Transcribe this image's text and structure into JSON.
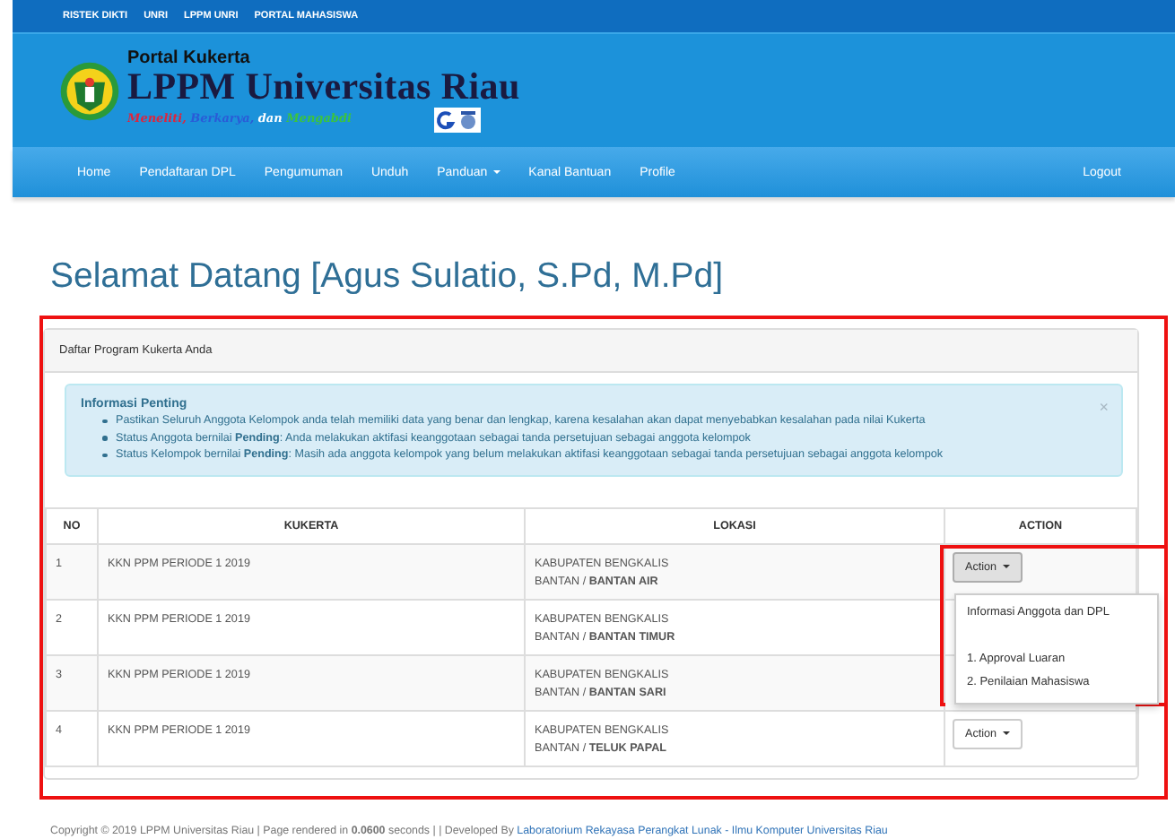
{
  "top_links": [
    "RISTEK DIKTI",
    "UNRI",
    "LPPM UNRI",
    "PORTAL MAHASISWA"
  ],
  "brand": {
    "subtitle": "Portal Kukerta",
    "title": "LPPM Universitas Riau",
    "motto": [
      {
        "text": "Meneliti,",
        "color": "#e0243c"
      },
      {
        "text": "Berkarya,",
        "color": "#2a5bd7"
      },
      {
        "text": "dan",
        "color": "#ffffff"
      },
      {
        "text": "Mengabdi",
        "color": "#3cc43c"
      }
    ]
  },
  "nav": {
    "items": [
      {
        "label": "Home",
        "dropdown": false
      },
      {
        "label": "Pendaftaran DPL",
        "dropdown": false
      },
      {
        "label": "Pengumuman",
        "dropdown": false
      },
      {
        "label": "Unduh",
        "dropdown": false
      },
      {
        "label": "Panduan",
        "dropdown": true
      },
      {
        "label": "Kanal Bantuan",
        "dropdown": false
      },
      {
        "label": "Profile",
        "dropdown": false
      }
    ],
    "right": "Logout"
  },
  "greeting": "Selamat Datang [Agus Sulatio, S.Pd, M.Pd]",
  "panel": {
    "heading": "Daftar Program Kukerta Anda",
    "alert": {
      "title": "Informasi Penting",
      "close": "×",
      "items": [
        "Pastikan Seluruh Anggota Kelompok anda telah memiliki data yang benar dan lengkap, karena kesalahan akan dapat menyebabkan kesalahan pada nilai Kukerta",
        "Status Anggota bernilai **Pending**: Anda melakukan aktifasi keanggotaan sebagai tanda persetujuan sebagai anggota kelompok",
        "Status Kelompok bernilai **Pending**: Masih ada anggota kelompok yang belum melakukan aktifasi keanggotaan sebagai tanda persetujuan sebagai anggota kelompok"
      ]
    },
    "table": {
      "columns": [
        "NO",
        "KUKERTA",
        "LOKASI",
        "ACTION"
      ],
      "rows": [
        {
          "no": "1",
          "kukerta": "KKN PPM PERIODE 1 2019",
          "lokasi": [
            "KABUPATEN BENGKALIS",
            "BANTAN / **BANTAN AIR**"
          ],
          "action": {
            "label": "Action",
            "expanded": true
          }
        },
        {
          "no": "2",
          "kukerta": "KKN PPM PERIODE 1 2019",
          "lokasi": [
            "KABUPATEN BENGKALIS",
            "BANTAN / **BANTAN TIMUR**"
          ]
        },
        {
          "no": "3",
          "kukerta": "KKN PPM PERIODE 1 2019",
          "lokasi": [
            "KABUPATEN BENGKALIS",
            "BANTAN / **BANTAN SARI**"
          ]
        },
        {
          "no": "4",
          "kukerta": "KKN PPM PERIODE 1 2019",
          "lokasi": [
            "KABUPATEN BENGKALIS",
            "BANTAN / **TELUK PAPAL**"
          ],
          "action": {
            "label": "Action",
            "expanded": false
          }
        }
      ]
    },
    "action_menu": [
      {
        "label": "Informasi Anggota dan DPL",
        "kind": "item"
      },
      {
        "kind": "divider"
      },
      {
        "label": "1. Approval Luaran",
        "kind": "item"
      },
      {
        "label": "2. Penilaian Mahasiswa",
        "kind": "item"
      }
    ]
  },
  "footer": {
    "text": "Copyright © 2019 LPPM Universitas Riau | Page rendered in **0.0600** seconds | | Developed By ",
    "link": "Laboratorium Rekayasa Perangkat Lunak - Ilmu Komputer Universitas Riau"
  }
}
